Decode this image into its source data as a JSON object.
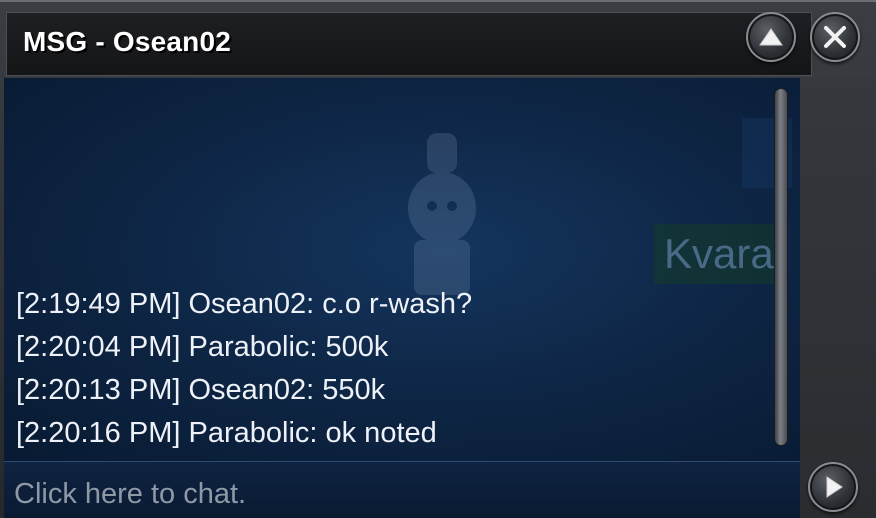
{
  "window": {
    "title": "MSG - Osean02"
  },
  "controls": {
    "minimize_icon": "up-arrow-icon",
    "close_icon": "close-icon",
    "send_icon": "play-arrow-icon"
  },
  "background": {
    "overlay_text": "Kvara"
  },
  "messages": [
    "[2:19:49 PM] Osean02: c.o r-wash?",
    "[2:20:04 PM] Parabolic: 500k",
    "[2:20:13 PM] Osean02: 550k",
    "[2:20:16 PM] Parabolic: ok noted"
  ],
  "input": {
    "placeholder": "Click here to chat."
  },
  "colors": {
    "chat_bg": "#0d2442",
    "text": "#eef2f8",
    "placeholder": "#8f99a6"
  }
}
